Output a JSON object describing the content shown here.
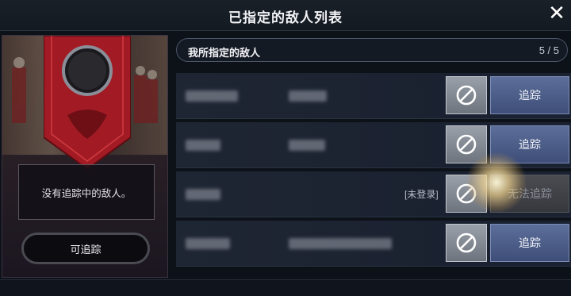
{
  "window": {
    "title": "已指定的敌人列表"
  },
  "left_panel": {
    "status_text": "没有追踪中的敌人。",
    "trackable_label": "可追踪"
  },
  "list": {
    "header_label": "我所指定的敌人",
    "count": "5 / 5",
    "rows": [
      {
        "offline_label": "",
        "block_icon": "block-icon",
        "track_label": "追踪",
        "track_enabled": true
      },
      {
        "offline_label": "",
        "block_icon": "block-icon",
        "track_label": "追踪",
        "track_enabled": true
      },
      {
        "offline_label": "[未登录]",
        "block_icon": "block-icon",
        "track_label": "无法追踪",
        "track_enabled": false
      },
      {
        "offline_label": "",
        "block_icon": "block-icon",
        "track_label": "追踪",
        "track_enabled": true
      }
    ]
  },
  "colors": {
    "track_button": "#4a5b86",
    "panel_accent": "#b8202a"
  }
}
